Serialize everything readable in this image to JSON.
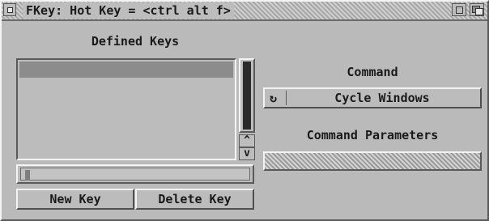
{
  "window": {
    "title": "FKey: Hot Key = <ctrl alt f>"
  },
  "defined_keys": {
    "label": "Defined Keys",
    "items": [
      ""
    ],
    "selected_index": 0,
    "input_value": ""
  },
  "buttons": {
    "new_key": "New Key",
    "delete_key": "Delete Key"
  },
  "command": {
    "label": "Command",
    "selected": "Cycle Windows",
    "cycle_glyph": "↻"
  },
  "command_parameters": {
    "label": "Command Parameters",
    "value": "",
    "disabled": true
  },
  "scroll": {
    "up_glyph": "^",
    "down_glyph": "v"
  },
  "colors": {
    "window_bg": "#bababa",
    "selection": "#8c8c8c",
    "text": "#1a1a1a"
  }
}
